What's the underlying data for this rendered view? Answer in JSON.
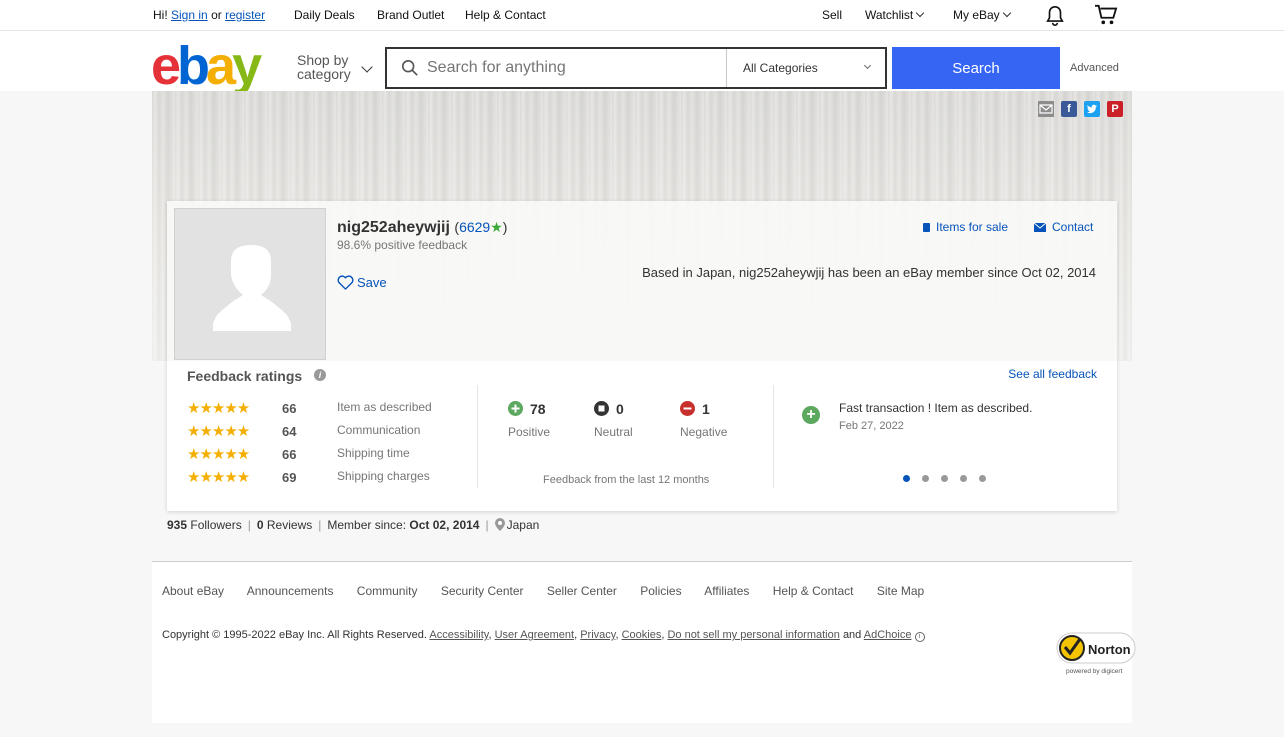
{
  "topbar": {
    "greeting": "Hi!",
    "sign_in": "Sign in",
    "or": "or",
    "register": "register",
    "daily_deals": "Daily Deals",
    "brand_outlet": "Brand Outlet",
    "help_contact": "Help & Contact",
    "sell": "Sell",
    "watchlist": "Watchlist",
    "my_ebay": "My eBay"
  },
  "header": {
    "shop_by": "Shop by",
    "category": "category",
    "search_placeholder": "Search for anything",
    "category_selected": "All Categories",
    "search_button": "Search",
    "advanced": "Advanced"
  },
  "profile": {
    "username": "nig252aheywjij",
    "feedback_score": "6629",
    "positive_feedback": "98.6% positive feedback",
    "save": "Save",
    "items_for_sale": "Items for sale",
    "contact": "Contact",
    "based_in": "Based in Japan, nig252aheywjij has been an eBay member since Oct 02, 2014"
  },
  "feedback": {
    "title": "Feedback ratings",
    "see_all": "See all feedback",
    "ratings": [
      {
        "count": "66",
        "label": "Item as described"
      },
      {
        "count": "64",
        "label": "Communication"
      },
      {
        "count": "66",
        "label": "Shipping time"
      },
      {
        "count": "69",
        "label": "Shipping charges"
      }
    ],
    "positive": {
      "count": "78",
      "label": "Positive"
    },
    "neutral": {
      "count": "0",
      "label": "Neutral"
    },
    "negative": {
      "count": "1",
      "label": "Negative"
    },
    "period": "Feedback from the last 12 months",
    "comment": "Fast transaction ! Item as described.",
    "comment_date": "Feb 27, 2022"
  },
  "stats": {
    "followers_count": "935",
    "followers_label": "Followers",
    "reviews_count": "0",
    "reviews_label": "Reviews",
    "member_since_label": "Member since:",
    "member_since": "Oct 02, 2014",
    "location": "Japan"
  },
  "footer": {
    "links": [
      "About eBay",
      "Announcements",
      "Community",
      "Security Center",
      "Seller Center",
      "Policies",
      "Affiliates",
      "Help & Contact",
      "Site Map"
    ],
    "copyright": "Copyright © 1995-2022 eBay Inc. All Rights Reserved.",
    "legal_links": [
      "Accessibility",
      "User Agreement",
      "Privacy",
      "Cookies",
      "Do not sell my personal information"
    ],
    "and": "and",
    "adchoice": "AdChoice",
    "norton": "Norton",
    "norton_sub": "powered by digicert"
  },
  "colors": {
    "ebay_e": "#e53238",
    "ebay_b": "#0064d2",
    "ebay_a": "#f5af02",
    "ebay_y": "#86b817",
    "search_button": "#3665f3",
    "link": "#0654ba"
  }
}
